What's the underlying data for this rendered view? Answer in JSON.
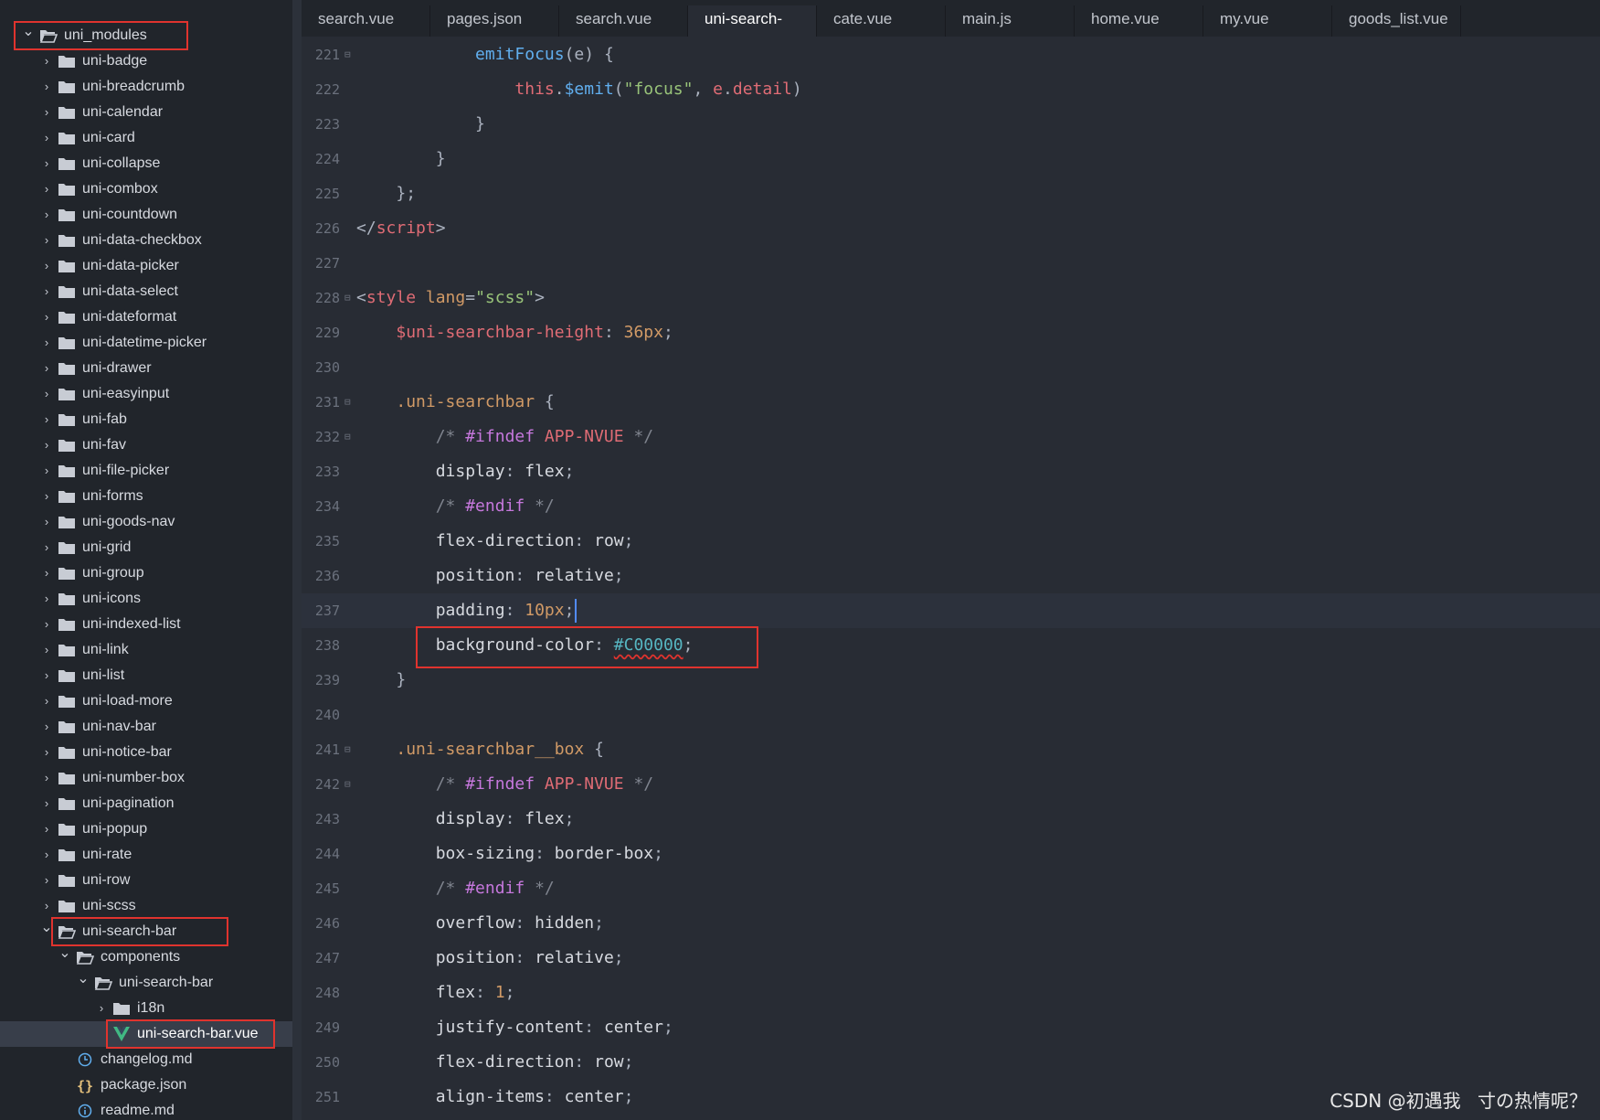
{
  "tabs": [
    {
      "label": "search.vue",
      "active": false
    },
    {
      "label": "pages.json",
      "active": false
    },
    {
      "label": "search.vue",
      "active": false
    },
    {
      "label": "uni-search-bar.vue",
      "active": true
    },
    {
      "label": "cate.vue",
      "active": false
    },
    {
      "label": "main.js",
      "active": false
    },
    {
      "label": "home.vue",
      "active": false
    },
    {
      "label": "my.vue",
      "active": false
    },
    {
      "label": "goods_list.vue",
      "active": false
    }
  ],
  "tree": [
    {
      "label": "uni_modules",
      "depth": 0,
      "type": "folder-open",
      "expanded": true,
      "highlight": true
    },
    {
      "label": "uni-badge",
      "depth": 1,
      "type": "folder",
      "expanded": false
    },
    {
      "label": "uni-breadcrumb",
      "depth": 1,
      "type": "folder",
      "expanded": false
    },
    {
      "label": "uni-calendar",
      "depth": 1,
      "type": "folder",
      "expanded": false
    },
    {
      "label": "uni-card",
      "depth": 1,
      "type": "folder",
      "expanded": false
    },
    {
      "label": "uni-collapse",
      "depth": 1,
      "type": "folder",
      "expanded": false
    },
    {
      "label": "uni-combox",
      "depth": 1,
      "type": "folder",
      "expanded": false
    },
    {
      "label": "uni-countdown",
      "depth": 1,
      "type": "folder",
      "expanded": false
    },
    {
      "label": "uni-data-checkbox",
      "depth": 1,
      "type": "folder",
      "expanded": false
    },
    {
      "label": "uni-data-picker",
      "depth": 1,
      "type": "folder",
      "expanded": false
    },
    {
      "label": "uni-data-select",
      "depth": 1,
      "type": "folder",
      "expanded": false
    },
    {
      "label": "uni-dateformat",
      "depth": 1,
      "type": "folder",
      "expanded": false
    },
    {
      "label": "uni-datetime-picker",
      "depth": 1,
      "type": "folder",
      "expanded": false
    },
    {
      "label": "uni-drawer",
      "depth": 1,
      "type": "folder",
      "expanded": false
    },
    {
      "label": "uni-easyinput",
      "depth": 1,
      "type": "folder",
      "expanded": false
    },
    {
      "label": "uni-fab",
      "depth": 1,
      "type": "folder",
      "expanded": false
    },
    {
      "label": "uni-fav",
      "depth": 1,
      "type": "folder",
      "expanded": false
    },
    {
      "label": "uni-file-picker",
      "depth": 1,
      "type": "folder",
      "expanded": false
    },
    {
      "label": "uni-forms",
      "depth": 1,
      "type": "folder",
      "expanded": false
    },
    {
      "label": "uni-goods-nav",
      "depth": 1,
      "type": "folder",
      "expanded": false
    },
    {
      "label": "uni-grid",
      "depth": 1,
      "type": "folder",
      "expanded": false
    },
    {
      "label": "uni-group",
      "depth": 1,
      "type": "folder",
      "expanded": false
    },
    {
      "label": "uni-icons",
      "depth": 1,
      "type": "folder",
      "expanded": false
    },
    {
      "label": "uni-indexed-list",
      "depth": 1,
      "type": "folder",
      "expanded": false
    },
    {
      "label": "uni-link",
      "depth": 1,
      "type": "folder",
      "expanded": false
    },
    {
      "label": "uni-list",
      "depth": 1,
      "type": "folder",
      "expanded": false
    },
    {
      "label": "uni-load-more",
      "depth": 1,
      "type": "folder",
      "expanded": false
    },
    {
      "label": "uni-nav-bar",
      "depth": 1,
      "type": "folder",
      "expanded": false
    },
    {
      "label": "uni-notice-bar",
      "depth": 1,
      "type": "folder",
      "expanded": false
    },
    {
      "label": "uni-number-box",
      "depth": 1,
      "type": "folder",
      "expanded": false
    },
    {
      "label": "uni-pagination",
      "depth": 1,
      "type": "folder",
      "expanded": false
    },
    {
      "label": "uni-popup",
      "depth": 1,
      "type": "folder",
      "expanded": false
    },
    {
      "label": "uni-rate",
      "depth": 1,
      "type": "folder",
      "expanded": false
    },
    {
      "label": "uni-row",
      "depth": 1,
      "type": "folder",
      "expanded": false
    },
    {
      "label": "uni-scss",
      "depth": 1,
      "type": "folder",
      "expanded": false
    },
    {
      "label": "uni-search-bar",
      "depth": 1,
      "type": "folder-open",
      "expanded": true,
      "highlight": true
    },
    {
      "label": "components",
      "depth": 2,
      "type": "folder-open",
      "expanded": true
    },
    {
      "label": "uni-search-bar",
      "depth": 3,
      "type": "folder-open",
      "expanded": true
    },
    {
      "label": "i18n",
      "depth": 4,
      "type": "folder",
      "expanded": false
    },
    {
      "label": "uni-search-bar.vue",
      "depth": 4,
      "type": "vue",
      "selected": true,
      "highlight": true
    },
    {
      "label": "changelog.md",
      "depth": 2,
      "type": "md"
    },
    {
      "label": "package.json",
      "depth": 2,
      "type": "json"
    },
    {
      "label": "readme.md",
      "depth": 2,
      "type": "info"
    }
  ],
  "code": [
    {
      "n": "221",
      "fold": true,
      "t": [
        [
          "",
          "\t\t\t"
        ],
        [
          "fn",
          "emitFocus"
        ],
        [
          "punc",
          "(e) {"
        ]
      ]
    },
    {
      "n": "222",
      "t": [
        [
          "",
          "\t\t\t\t"
        ],
        [
          "kw",
          "this"
        ],
        [
          "punc",
          "."
        ],
        [
          "fn",
          "$emit"
        ],
        [
          "punc",
          "("
        ],
        [
          "str",
          "\"focus\""
        ],
        [
          "punc",
          ", "
        ],
        [
          "kw",
          "e"
        ],
        [
          "punc",
          "."
        ],
        [
          "kw",
          "detail"
        ],
        [
          "punc",
          ")"
        ]
      ]
    },
    {
      "n": "223",
      "t": [
        [
          "",
          "\t\t\t"
        ],
        [
          "punc",
          "}"
        ]
      ]
    },
    {
      "n": "224",
      "t": [
        [
          "",
          "\t\t"
        ],
        [
          "punc",
          "}"
        ]
      ]
    },
    {
      "n": "225",
      "t": [
        [
          "",
          "\t"
        ],
        [
          "punc",
          "};"
        ]
      ]
    },
    {
      "n": "226",
      "t": [
        [
          "punc",
          "</"
        ],
        [
          "kw",
          "script"
        ],
        [
          "punc",
          ">"
        ]
      ]
    },
    {
      "n": "227",
      "t": []
    },
    {
      "n": "228",
      "fold": true,
      "t": [
        [
          "punc",
          "<"
        ],
        [
          "kw",
          "style"
        ],
        [
          "punc",
          " "
        ],
        [
          "attr",
          "lang"
        ],
        [
          "punc",
          "="
        ],
        [
          "str",
          "\"scss\""
        ],
        [
          "punc",
          ">"
        ]
      ]
    },
    {
      "n": "229",
      "t": [
        [
          "",
          "\t"
        ],
        [
          "var",
          "$uni-searchbar-height"
        ],
        [
          "punc",
          ": "
        ],
        [
          "num",
          "36px"
        ],
        [
          "punc",
          ";"
        ]
      ]
    },
    {
      "n": "230",
      "t": []
    },
    {
      "n": "231",
      "fold": true,
      "t": [
        [
          "",
          "\t"
        ],
        [
          "sel",
          ".uni-searchbar"
        ],
        [
          "punc",
          " {"
        ]
      ]
    },
    {
      "n": "232",
      "fold": true,
      "t": [
        [
          "",
          "\t\t"
        ],
        [
          "com",
          "/* "
        ],
        [
          "dir",
          "#ifndef"
        ],
        [
          "prop",
          " APP-NVUE"
        ],
        [
          "com",
          " */"
        ]
      ]
    },
    {
      "n": "233",
      "t": [
        [
          "",
          "\t\t"
        ],
        [
          "",
          "display"
        ],
        [
          "punc",
          ": "
        ],
        [
          "",
          "flex"
        ],
        [
          "punc",
          ";"
        ]
      ]
    },
    {
      "n": "234",
      "t": [
        [
          "",
          "\t\t"
        ],
        [
          "com",
          "/* "
        ],
        [
          "dir",
          "#endif"
        ],
        [
          "com",
          " */"
        ]
      ]
    },
    {
      "n": "235",
      "t": [
        [
          "",
          "\t\t"
        ],
        [
          "",
          "flex-direction"
        ],
        [
          "punc",
          ": "
        ],
        [
          "",
          "row"
        ],
        [
          "punc",
          ";"
        ]
      ]
    },
    {
      "n": "236",
      "t": [
        [
          "",
          "\t\t"
        ],
        [
          "",
          "position"
        ],
        [
          "punc",
          ": "
        ],
        [
          "",
          "relative"
        ],
        [
          "punc",
          ";"
        ]
      ]
    },
    {
      "n": "237",
      "current": true,
      "cursor": true,
      "t": [
        [
          "",
          "\t\t"
        ],
        [
          "",
          "padding"
        ],
        [
          "punc",
          ": "
        ],
        [
          "num",
          "10px"
        ],
        [
          "punc",
          ";"
        ]
      ]
    },
    {
      "n": "238",
      "box": true,
      "t": [
        [
          "",
          "\t\t"
        ],
        [
          "",
          "background-color"
        ],
        [
          "punc",
          ": "
        ],
        [
          "hex",
          "#C00000"
        ],
        [
          "punc",
          ";"
        ]
      ]
    },
    {
      "n": "239",
      "t": [
        [
          "",
          "\t"
        ],
        [
          "punc",
          "}"
        ]
      ]
    },
    {
      "n": "240",
      "t": []
    },
    {
      "n": "241",
      "fold": true,
      "t": [
        [
          "",
          "\t"
        ],
        [
          "sel",
          ".uni-searchbar__box"
        ],
        [
          "punc",
          " {"
        ]
      ]
    },
    {
      "n": "242",
      "fold": true,
      "t": [
        [
          "",
          "\t\t"
        ],
        [
          "com",
          "/* "
        ],
        [
          "dir",
          "#ifndef"
        ],
        [
          "prop",
          " APP-NVUE"
        ],
        [
          "com",
          " */"
        ]
      ]
    },
    {
      "n": "243",
      "t": [
        [
          "",
          "\t\t"
        ],
        [
          "",
          "display"
        ],
        [
          "punc",
          ": "
        ],
        [
          "",
          "flex"
        ],
        [
          "punc",
          ";"
        ]
      ]
    },
    {
      "n": "244",
      "t": [
        [
          "",
          "\t\t"
        ],
        [
          "",
          "box-sizing"
        ],
        [
          "punc",
          ": "
        ],
        [
          "",
          "border-box"
        ],
        [
          "punc",
          ";"
        ]
      ]
    },
    {
      "n": "245",
      "t": [
        [
          "",
          "\t\t"
        ],
        [
          "com",
          "/* "
        ],
        [
          "dir",
          "#endif"
        ],
        [
          "com",
          " */"
        ]
      ]
    },
    {
      "n": "246",
      "t": [
        [
          "",
          "\t\t"
        ],
        [
          "",
          "overflow"
        ],
        [
          "punc",
          ": "
        ],
        [
          "",
          "hidden"
        ],
        [
          "punc",
          ";"
        ]
      ]
    },
    {
      "n": "247",
      "t": [
        [
          "",
          "\t\t"
        ],
        [
          "",
          "position"
        ],
        [
          "punc",
          ": "
        ],
        [
          "",
          "relative"
        ],
        [
          "punc",
          ";"
        ]
      ]
    },
    {
      "n": "248",
      "t": [
        [
          "",
          "\t\t"
        ],
        [
          "",
          "flex"
        ],
        [
          "punc",
          ": "
        ],
        [
          "num",
          "1"
        ],
        [
          "punc",
          ";"
        ]
      ]
    },
    {
      "n": "249",
      "t": [
        [
          "",
          "\t\t"
        ],
        [
          "",
          "justify-content"
        ],
        [
          "punc",
          ": "
        ],
        [
          "",
          "center"
        ],
        [
          "punc",
          ";"
        ]
      ]
    },
    {
      "n": "250",
      "t": [
        [
          "",
          "\t\t"
        ],
        [
          "",
          "flex-direction"
        ],
        [
          "punc",
          ": "
        ],
        [
          "",
          "row"
        ],
        [
          "punc",
          ";"
        ]
      ]
    },
    {
      "n": "251",
      "t": [
        [
          "",
          "\t\t"
        ],
        [
          "",
          "align-items"
        ],
        [
          "punc",
          ": "
        ],
        [
          "",
          "center"
        ],
        [
          "punc",
          ";"
        ]
      ]
    }
  ],
  "watermark": "CSDN @初遇我ㅤ寸の热情呢？",
  "colors": {
    "highlight_box": "#e0332e",
    "active_tab": "#282c34",
    "sidebar": "#21252b"
  }
}
